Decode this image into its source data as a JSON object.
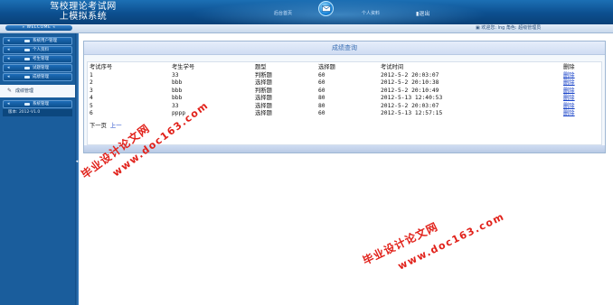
{
  "header": {
    "title_line1": "驾校理论考试网",
    "title_line2": "上模拟系统",
    "link_left": "后台首页",
    "link_right": "个人资料",
    "logout": "退出"
  },
  "subbar": {
    "welcome": "WELCOME",
    "user_info": "欢迎您: lng 角色: 超级管理员"
  },
  "sidebar": {
    "items": [
      {
        "label": "系统用户管理"
      },
      {
        "label": "个人资料"
      },
      {
        "label": "考生管理"
      },
      {
        "label": "试题管理"
      },
      {
        "label": "成绩管理"
      }
    ],
    "active": {
      "label": "成绩管理"
    },
    "items_after": [
      {
        "label": "系统管理"
      }
    ],
    "version": "版本: 2012-V1.0"
  },
  "panel": {
    "title": "成绩查询",
    "columns": [
      "考试序号",
      "考生学号",
      "题型",
      "选择题",
      "考试时间",
      "删除"
    ],
    "rows": [
      [
        "1",
        "33",
        "判断题",
        "60",
        "2012-5-2 20:03:07",
        "删除"
      ],
      [
        "2",
        "bbb",
        "选择题",
        "60",
        "2012-5-2 20:10:38",
        "删除"
      ],
      [
        "3",
        "bbb",
        "判断题",
        "60",
        "2012-5-2 20:10:49",
        "删除"
      ],
      [
        "4",
        "bbb",
        "选择题",
        "80",
        "2012-5-13 12:40:53",
        "删除"
      ],
      [
        "5",
        "33",
        "选择题",
        "80",
        "2012-5-2 20:03:07",
        "删除"
      ],
      [
        "6",
        "pppp",
        "选择题",
        "60",
        "2012-5-13 12:57:15",
        "删除"
      ]
    ],
    "pager": {
      "next": "下一页",
      "prev": "上一"
    }
  },
  "watermark": {
    "cn": "毕业设计论文网",
    "url": "www.doc163.com"
  },
  "colors": {
    "header": "#0c4f8f",
    "sidebar": "#1a5d9c",
    "link": "#1a44c8",
    "watermark": "#e1211a"
  }
}
